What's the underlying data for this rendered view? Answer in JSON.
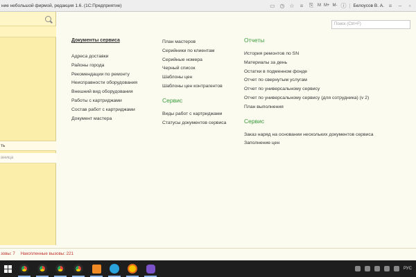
{
  "window": {
    "title": "ние небольшой фирмой, редакция 1.6. (1С:Предприятие)",
    "user": "Белоусов В. А."
  },
  "toolbar": {
    "icons": [
      "chat-icon",
      "history-icon",
      "star-icon",
      "list-icon",
      "clip-icon",
      "memory-icon",
      "minimize-icon",
      "restore-icon"
    ],
    "m_labels": [
      "M",
      "M+",
      "M-"
    ]
  },
  "left": {
    "item_1": "ть",
    "item_2": "аница"
  },
  "search": {
    "placeholder": "Поиск (Ctrl+F)"
  },
  "columns": {
    "col1": {
      "title": "Документы сервиса",
      "items": [
        "Адреса доставки",
        "Районы города",
        "Рекомендации по ремонту",
        "Неисправности оборудования",
        "Внешний вид оборудования",
        "Работы с картриджами",
        "Состав работ с картриджами",
        "Документ мастера"
      ]
    },
    "col2": {
      "items": [
        "План мастеров",
        "Серийники по клиентам",
        "Серийные номера",
        "Черный список",
        "Шаблоны цен",
        "Шаблоны цен контрагентов"
      ],
      "section": "Сервис",
      "section_items": [
        "Виды работ с картриджами",
        "Статусы документов сервиса"
      ]
    },
    "col3": {
      "title": "Отчеты",
      "items": [
        "История ремонтов по SN",
        "Материалы за день",
        "Остатки в подменном фонде",
        "Отчет по свернутым услугам",
        "Отчет по универсальному сервису",
        "Отчет по универсальному сервису (для сотрудника) (v 2)",
        "План выполнения"
      ],
      "section": "Сервис",
      "section_items": [
        "Заказ наряд на основании нескольких документов сервиса",
        "Заполнение цен"
      ]
    }
  },
  "status": {
    "left": "зовы: 7",
    "right": "Накопленные вызовы: 221"
  },
  "taskbar": {
    "apps": [
      "chrome",
      "chrome",
      "chrome",
      "chrome",
      "sublime",
      "telegram",
      "1c",
      "viber"
    ],
    "colors": [
      "#e8453c",
      "#e8453c",
      "#e8453c",
      "#e8453c",
      "#f08a24",
      "#2aa3dd",
      "#f4c400",
      "#7b52c7"
    ],
    "lang": "РУС"
  }
}
